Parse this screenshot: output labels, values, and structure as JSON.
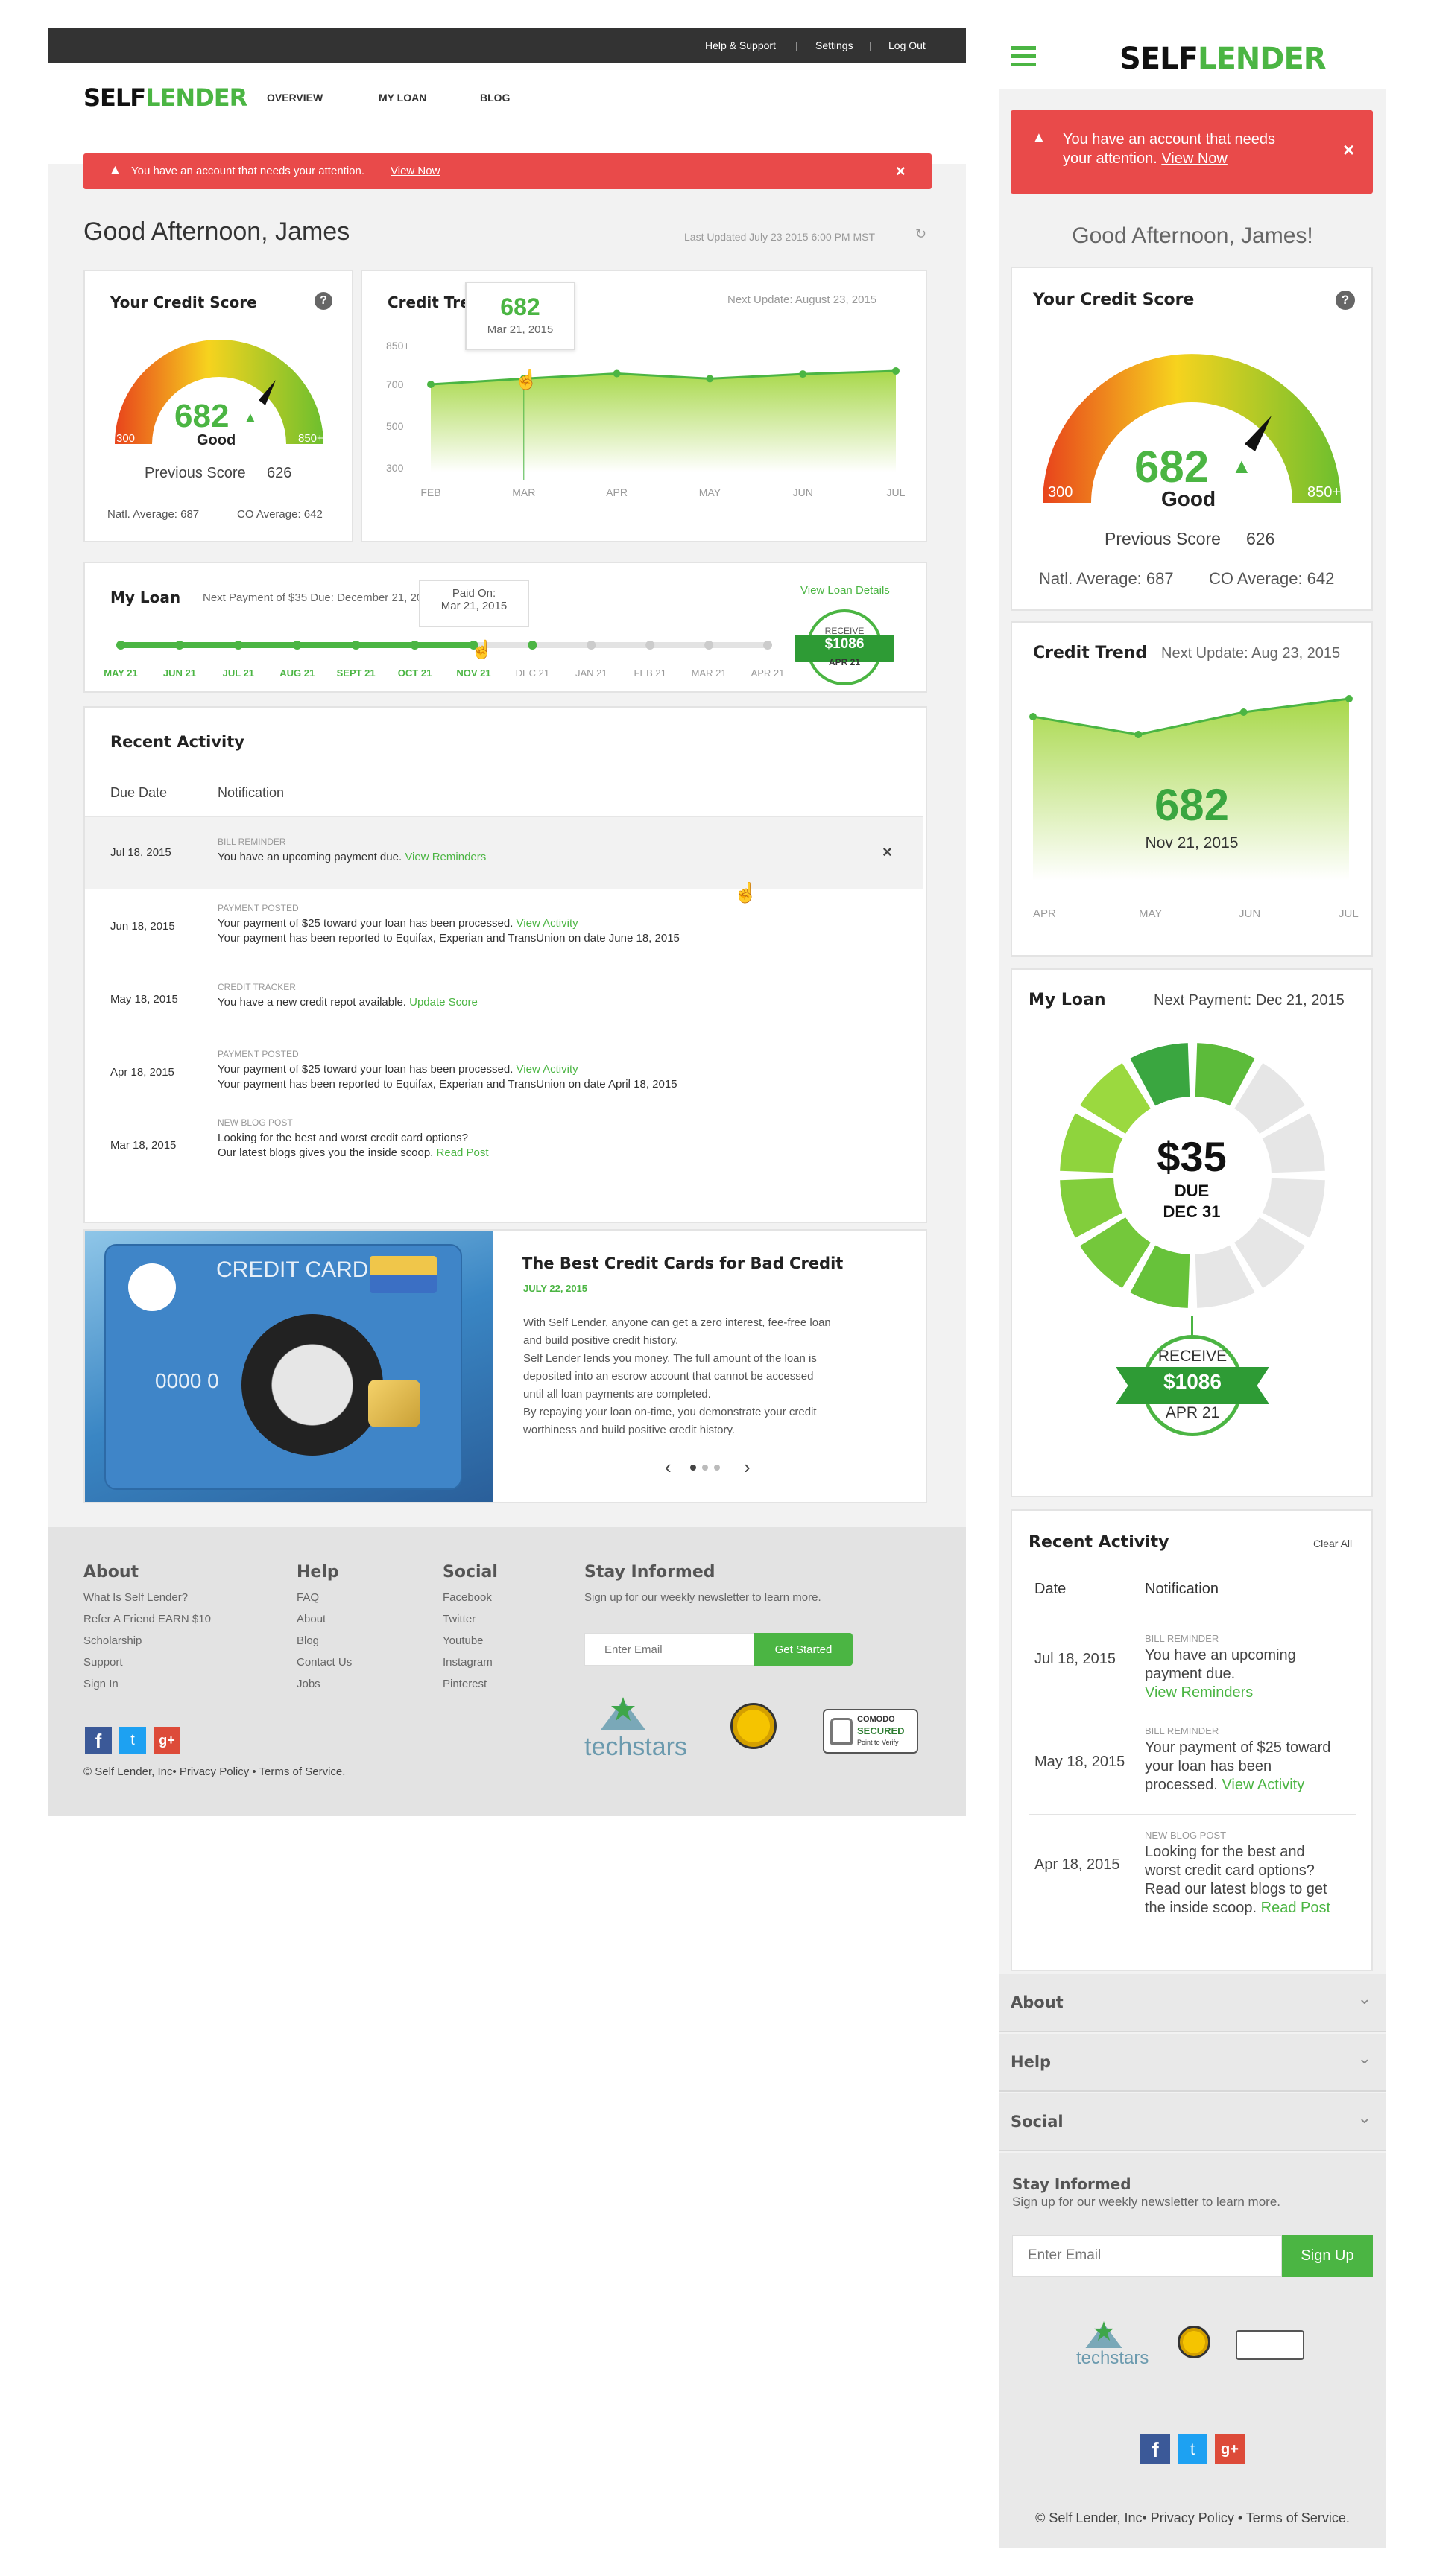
{
  "desktop": {
    "topbar": {
      "help": "Help & Support",
      "sep1": "|",
      "settings": "Settings",
      "sep2": "|",
      "logout": "Log Out"
    },
    "logo_a": "SELF",
    "logo_b": "LENDER",
    "nav": {
      "overview": "OVERVIEW",
      "myloan": "MY LOAN",
      "blog": "BLOG"
    },
    "alert": {
      "text": "You have an account that needs your attention.",
      "link": "View Now",
      "close": "×"
    },
    "greeting": "Good Afternoon, James",
    "last_updated": "Last Updated July 23 2015 6:00 PM MST",
    "score": {
      "title": "Your Credit Score",
      "help": "?",
      "value": "682",
      "rating": "Good",
      "min": "300",
      "max": "850+",
      "prev_label": "Previous Score",
      "prev": "626",
      "natl": "Natl. Average: 687",
      "co": "CO Average: 642"
    },
    "trend": {
      "title": "Credit Trend",
      "next": "Next Update:  August 23, 2015",
      "tooltip_value": "682",
      "tooltip_date": "Mar 21, 2015"
    },
    "loan": {
      "title": "My Loan",
      "next": "Next Payment of $35 Due: December 21, 2015",
      "details": "View Loan Details",
      "tip_a": "Paid On:",
      "tip_b": "Mar 21, 2015",
      "badge_a": "RECEIVE",
      "badge_b": "$1086",
      "badge_c": "APR 21",
      "months": [
        "MAY 21",
        "JUN 21",
        "JUL 21",
        "AUG 21",
        "SEPT 21",
        "OCT 21",
        "NOV 21",
        "DEC 21",
        "JAN 21",
        "FEB 21",
        "MAR 21",
        "APR 21"
      ]
    },
    "activity": {
      "title": "Recent Activity",
      "col_date": "Due Date",
      "col_note": "Notification",
      "close": "×",
      "rows": [
        {
          "date": "Jul 18, 2015",
          "tag": "BILL REMINDER",
          "l1": "You have an upcoming payment due.",
          "link": "View Reminders",
          "l2": ""
        },
        {
          "date": "Jun 18, 2015",
          "tag": "PAYMENT POSTED",
          "l1": "Your payment of $25 toward your loan has been processed.",
          "link": "View Activity",
          "l2": "Your payment has been reported to Equifax, Experian and TransUnion on date June 18, 2015"
        },
        {
          "date": "May 18, 2015",
          "tag": "CREDIT TRACKER",
          "l1": "You have a new credit repot available.",
          "link": "Update Score",
          "l2": ""
        },
        {
          "date": "Apr 18, 2015",
          "tag": "PAYMENT POSTED",
          "l1": "Your payment of $25 toward your loan has been processed.",
          "link": "View Activity",
          "l2": "Your payment has been reported to Equifax, Experian and TransUnion on date April 18, 2015"
        },
        {
          "date": "Mar 18, 2015",
          "tag": "NEW BLOG POST",
          "l1": "Looking for the best and worst credit card options?",
          "link": "",
          "l2": "Our latest blogs gives you the inside scoop.",
          "link2": "Read Post"
        }
      ]
    },
    "blog": {
      "title": "The Best Credit Cards for Bad Credit",
      "date": "JULY 22, 2015",
      "card_label": "CREDIT CARD",
      "card_num": "0000 0",
      "p1": "With Self Lender, anyone can get a zero interest, fee-free loan",
      "p2": "and build positive credit history.",
      "p3": "Self Lender lends you money. The full amount of the loan is",
      "p4": "deposited into an escrow account that cannot be accessed",
      "p5": "until all loan payments are completed.",
      "p6": "By repaying your loan on-time, you demonstrate your credit",
      "p7": "worthiness and build positive credit history.",
      "prev": "‹",
      "next": "›"
    },
    "footer": {
      "about": "About",
      "about_links": [
        "What Is Self Lender?",
        "Refer A Friend    EARN $10",
        "Scholarship",
        "Support",
        "Sign In"
      ],
      "help": "Help",
      "help_links": [
        "FAQ",
        "About",
        "Blog",
        "Contact Us",
        "Jobs"
      ],
      "social": "Social",
      "social_links": [
        "Facebook",
        "Twitter",
        "Youtube",
        "Instagram",
        "Pinterest"
      ],
      "stay": "Stay Informed",
      "stay_sub": "Sign up for our weekly newsletter to learn more.",
      "email_ph": "Enter Email",
      "cta": "Get Started",
      "copyright": "© Self Lender, Inc• Privacy Policy • Terms of Service.",
      "techstars": "techstars",
      "comodo_a": "COMODO",
      "comodo_b": "SECURED",
      "comodo_c": "Point to Verify"
    }
  },
  "mobile": {
    "logo_a": "SELF",
    "logo_b": "LENDER",
    "alert": {
      "text": "You have an account that needs",
      "text2": "your attention.",
      "link": "View Now",
      "close": "×"
    },
    "greeting": "Good Afternoon, James!",
    "score": {
      "title": "Your Credit Score",
      "help": "?",
      "value": "682",
      "rating": "Good",
      "min": "300",
      "max": "850+",
      "prev_label": "Previous Score",
      "prev": "626",
      "natl": "Natl. Average: 687",
      "co": "CO Average: 642"
    },
    "trend": {
      "title": "Credit Trend",
      "next": "Next Update: Aug 23, 2015",
      "value": "682",
      "date": "Nov 21, 2015",
      "months": [
        "APR",
        "MAY",
        "JUN",
        "JUL"
      ]
    },
    "loan": {
      "title": "My Loan",
      "next": "Next Payment: Dec 21, 2015",
      "amount": "$35",
      "due": "DUE",
      "due_date": "DEC 31",
      "badge_a": "RECEIVE",
      "badge_b": "$1086",
      "badge_c": "APR 21",
      "paid_segments": 7,
      "total_segments": 12
    },
    "activity": {
      "title": "Recent Activity",
      "clear": "Clear All",
      "col_date": "Date",
      "col_note": "Notification",
      "r1_date": "Jul 18, 2015",
      "r1_tag": "BILL REMINDER",
      "r1_a": "You have an upcoming",
      "r1_b": "payment due.",
      "r1_link": "View Reminders",
      "r2_date": "May 18, 2015",
      "r2_tag": "BILL REMINDER",
      "r2_a": "Your payment of $25 toward",
      "r2_b": "your loan has been",
      "r2_c": "processed.",
      "r2_link": "View Activity",
      "r3_date": "Apr 18, 2015",
      "r3_tag": "NEW BLOG POST",
      "r3_a": "Looking for the best and",
      "r3_b": "worst credit card options?",
      "r3_c": "Read our latest blogs to get",
      "r3_d": "the inside scoop.",
      "r3_link": "Read Post"
    },
    "footer": {
      "about": "About",
      "help": "Help",
      "social": "Social",
      "chev": "⌄",
      "stay": "Stay Informed",
      "stay_sub": "Sign up for our weekly newsletter to learn more.",
      "email_ph": "Enter Email",
      "cta": "Sign Up",
      "techstars": "techstars",
      "copyright": "© Self Lender, Inc• Privacy Policy • Terms of Service."
    }
  },
  "chart_data": [
    {
      "type": "line",
      "title": "Credit Trend",
      "categories": [
        "FEB",
        "MAR",
        "APR",
        "MAY",
        "JUN",
        "JUL"
      ],
      "values": [
        700,
        722,
        742,
        722,
        740,
        752
      ],
      "yticks": [
        "850+",
        "700",
        "500",
        "300"
      ],
      "ylim": [
        300,
        850
      ]
    },
    {
      "type": "area",
      "title": "Credit Trend",
      "categories": [
        "APR",
        "MAY",
        "JUN",
        "JUL"
      ],
      "values": [
        670,
        662,
        672,
        678
      ]
    }
  ],
  "colors": {
    "green": "#4bb543",
    "red": "#e94a4a",
    "dark": "#333333"
  }
}
